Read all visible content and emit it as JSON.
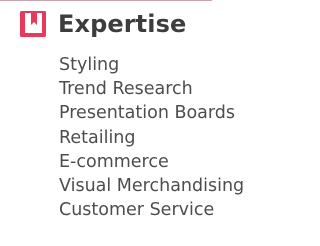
{
  "section": {
    "icon": "book-icon",
    "accent_color": "#e8395d",
    "title": "Expertise",
    "items": [
      "Styling",
      "Trend Research",
      "Presentation Boards",
      "Retailing",
      "E-commerce",
      "Visual Merchandising",
      "Customer Service"
    ]
  }
}
